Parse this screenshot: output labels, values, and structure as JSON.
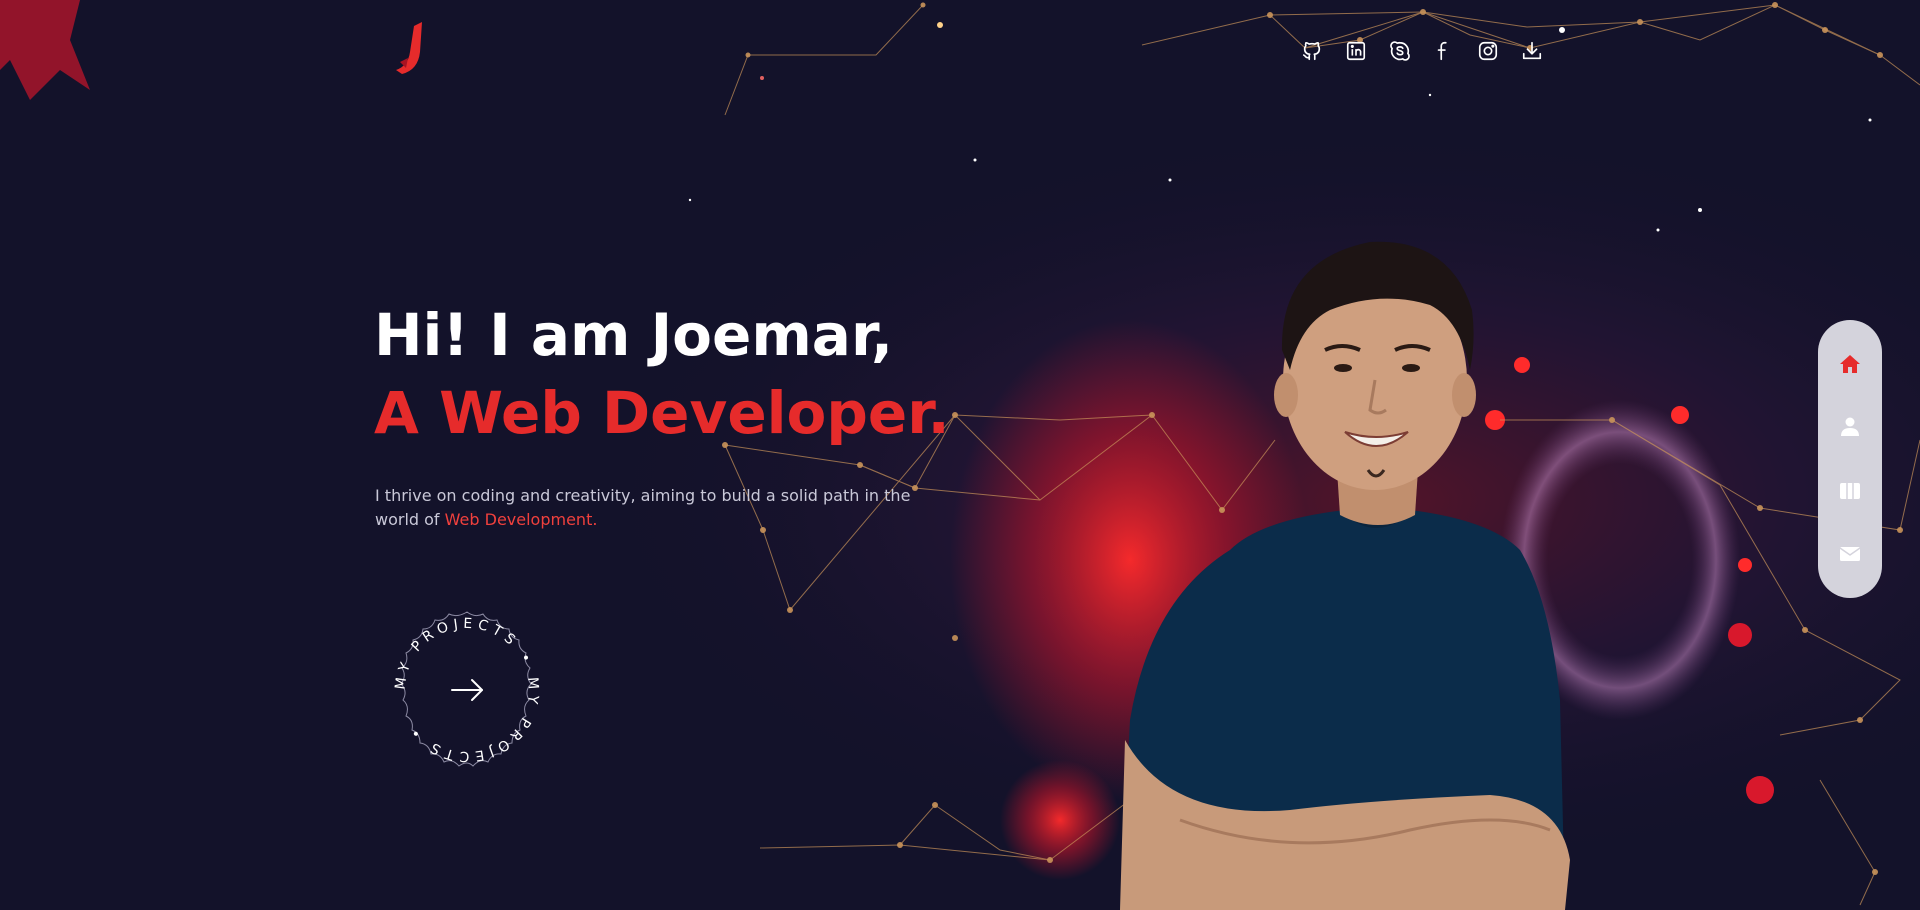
{
  "brand": {
    "logo_icon": "j-letter-logo-icon",
    "accent": "#e62b2b"
  },
  "social_links": [
    {
      "name": "github",
      "icon": "github-icon"
    },
    {
      "name": "linkedin",
      "icon": "linkedin-icon"
    },
    {
      "name": "skype",
      "icon": "skype-icon"
    },
    {
      "name": "facebook",
      "icon": "facebook-icon"
    },
    {
      "name": "instagram",
      "icon": "instagram-icon"
    },
    {
      "name": "download",
      "icon": "download-icon"
    }
  ],
  "hero": {
    "greeting": "Hi! I am Joemar,",
    "role": "A Web Developer.",
    "description_prefix": "I thrive on coding and creativity, aiming to build a solid path in the world of ",
    "description_highlight": "Web Development."
  },
  "projects_button": {
    "label": "MY PROJECTS • MY PROJECTS •",
    "icon": "arrow-right-icon"
  },
  "side_nav": [
    {
      "name": "home",
      "icon": "home-icon",
      "active": true,
      "color": "#e62b2b"
    },
    {
      "name": "about",
      "icon": "user-icon",
      "active": false,
      "color": "#ffffff"
    },
    {
      "name": "projects",
      "icon": "columns-icon",
      "active": false,
      "color": "#ffffff"
    },
    {
      "name": "contact",
      "icon": "mail-icon",
      "active": false,
      "color": "#ffffff"
    }
  ]
}
